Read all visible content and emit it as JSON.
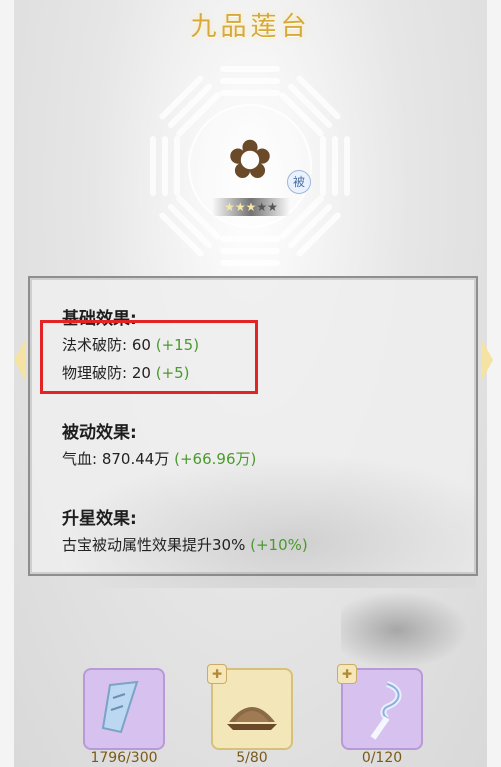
{
  "title": "九品莲台",
  "badge_text": "被",
  "stars": {
    "filled": 3,
    "total": 5
  },
  "sections": {
    "base": {
      "heading": "基础效果:",
      "lines": [
        {
          "label": "法术破防:",
          "value": "60",
          "bonus": "(+15)"
        },
        {
          "label": "物理破防:",
          "value": "20",
          "bonus": "(+5)"
        }
      ]
    },
    "passive": {
      "heading": "被动效果:",
      "lines": [
        {
          "label": "气血:",
          "value": "870.44万",
          "bonus": "(+66.96万)"
        }
      ]
    },
    "star": {
      "heading": "升星效果:",
      "lines": [
        {
          "label": "古宝被动属性效果提升30%",
          "bonus": "(+10%)"
        }
      ]
    }
  },
  "items": [
    {
      "name": "sword-scroll",
      "count": "1796/300"
    },
    {
      "name": "lotus-seat",
      "count": "5/80"
    },
    {
      "name": "spirit-key",
      "count": "0/120"
    }
  ],
  "colors": {
    "title": "#d6a93a",
    "bonus_green": "#4a9a2e",
    "highlight_red": "#e32424"
  }
}
